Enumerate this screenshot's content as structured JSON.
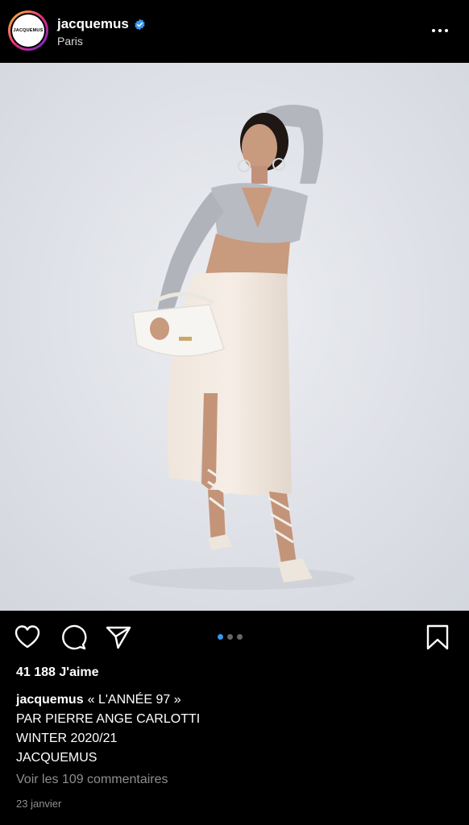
{
  "post": {
    "username": "jacquemus",
    "location": "Paris",
    "avatar_text": "JACQUEMUS",
    "likes": "41 188 J'aime",
    "caption_user": "jacquemus",
    "caption_lines": [
      "« L'ANNÉE 97 »",
      "PAR PIERRE ANGE CARLOTTI",
      "WINTER 2020/21",
      "JACQUEMUS"
    ],
    "comments_link": "Voir les 109 commentaires",
    "date": "23 janvier",
    "carousel": {
      "total": 3,
      "active": 1
    }
  },
  "icons": {
    "more": "more-horizontal-icon",
    "like": "heart-icon",
    "comment": "comment-icon",
    "share": "send-icon",
    "save": "bookmark-icon",
    "verified": "verified-badge-icon"
  },
  "colors": {
    "background": "#000000",
    "verified": "#3897f0",
    "muted_text": "#8e8e8e",
    "carousel_active": "#3897f0"
  }
}
